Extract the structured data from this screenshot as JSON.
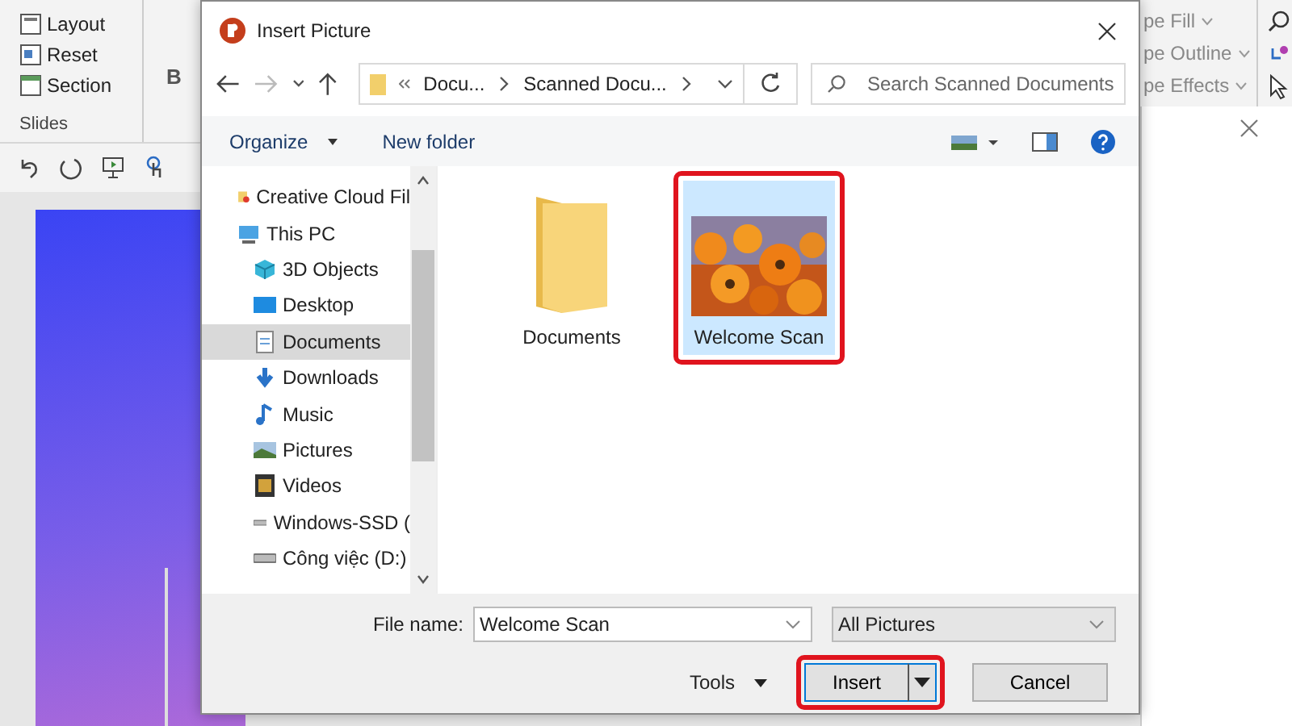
{
  "app": {
    "ribbon_left": [
      {
        "label": "Layout",
        "kind": "layout"
      },
      {
        "label": "Reset",
        "kind": "reset"
      },
      {
        "label": "Section",
        "kind": "section"
      }
    ],
    "group_label": "Slides",
    "bold_button": "B",
    "ribbon_right": [
      "pe Fill",
      "pe Outline",
      "pe Effects"
    ]
  },
  "dialog": {
    "title": "Insert Picture",
    "breadcrumb": [
      "Docu...",
      "Scanned Docu..."
    ],
    "search": {
      "placeholder": "Search Scanned Documents"
    },
    "toolbar": [
      "Organize",
      "New folder"
    ],
    "nav": [
      {
        "label": "Creative Cloud Fil",
        "kind": "cloud",
        "selected": false
      },
      {
        "label": "This PC",
        "kind": "pc",
        "selected": false,
        "children": [
          {
            "label": "3D Objects",
            "kind": "cube",
            "selected": false
          },
          {
            "label": "Desktop",
            "kind": "desktop",
            "selected": false
          },
          {
            "label": "Documents",
            "kind": "docs",
            "selected": true
          },
          {
            "label": "Downloads",
            "kind": "download",
            "selected": false
          },
          {
            "label": "Music",
            "kind": "music",
            "selected": false
          },
          {
            "label": "Pictures",
            "kind": "pictures",
            "selected": false
          },
          {
            "label": "Videos",
            "kind": "videos",
            "selected": false
          },
          {
            "label": "Windows-SSD (",
            "kind": "drive",
            "selected": false
          },
          {
            "label": "Công việc (D:)",
            "kind": "drive",
            "selected": false
          }
        ]
      }
    ],
    "files": [
      {
        "name": "Documents",
        "kind": "folder",
        "selected": false,
        "highlighted": false
      },
      {
        "name": "Welcome Scan",
        "kind": "picture",
        "selected": true,
        "highlighted": true
      }
    ],
    "file_name_label": "File name:",
    "file_name": "Welcome Scan",
    "file_type": "All Pictures",
    "tools": "Tools",
    "buttons": [
      {
        "label": "Insert",
        "kind": "split",
        "highlighted": true
      },
      {
        "label": "Cancel",
        "kind": "plain",
        "highlighted": false
      }
    ]
  }
}
